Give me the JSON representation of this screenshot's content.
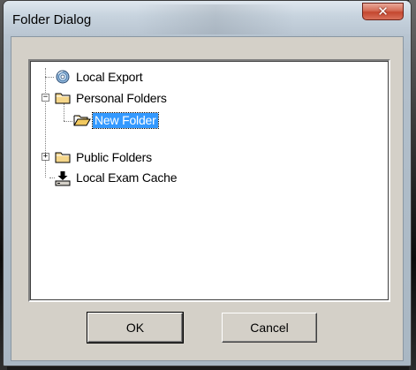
{
  "window": {
    "title": "Folder Dialog",
    "close_glyph": "✕"
  },
  "tree": {
    "items": [
      {
        "label": "Local Export",
        "icon": "disc-icon"
      },
      {
        "label": "Personal Folders",
        "icon": "folder-icon",
        "expander": "−"
      },
      {
        "label": "New Folder",
        "icon": "open-folder-icon",
        "selected": true
      },
      {
        "label": "Public Folders",
        "icon": "folder-icon",
        "expander": "+"
      },
      {
        "label": "Local Exam Cache",
        "icon": "download-drive-icon"
      }
    ]
  },
  "buttons": {
    "ok": "OK",
    "cancel": "Cancel"
  },
  "colors": {
    "selection": "#3399ff",
    "dialog_bg": "#d4d0c8",
    "close_button": "#c4472f"
  }
}
